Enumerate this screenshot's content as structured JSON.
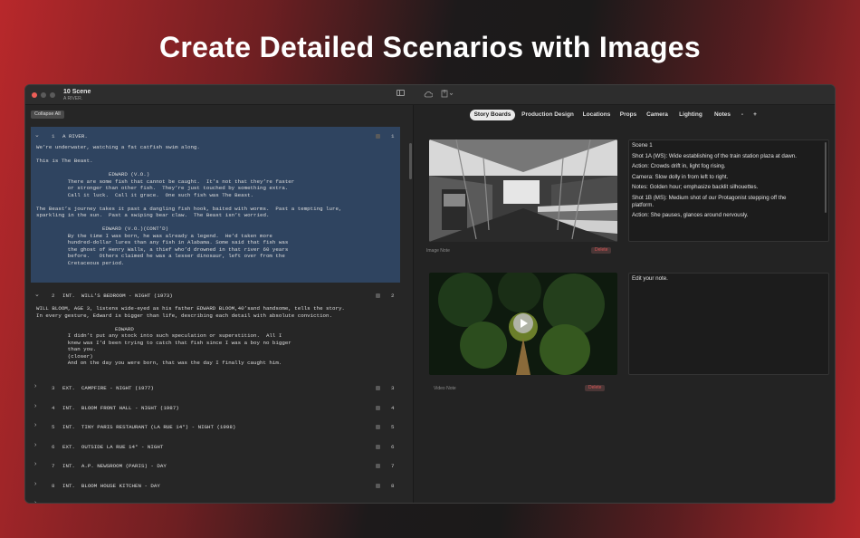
{
  "headline": "Create Detailed Scenarios with Images",
  "window": {
    "title": "10 Scene",
    "subtitle": "A RIVER."
  },
  "script": {
    "collapse_label": "Collapse All",
    "scene1": {
      "chevron": "⌄",
      "num": "1",
      "heading": "A RIVER.",
      "right_num": "1",
      "lines": [
        "We’re underwater, watching a fat catfish swim along.",
        "",
        "This is The Beast.",
        "",
        "                       EDWARD (V.O.)",
        "          There are some fish that cannot be caught.  It’s not that they’re faster",
        "          or stronger than other fish.  They’re just touched by something extra.",
        "          Call it luck.  Call it grace.  One such fish was The Beast.",
        "",
        "The Beast’s journey takes it past a dangling fish hook, baited with worms.  Past a tempting lure,",
        "sparkling in the sun.  Past a swiping bear claw.  The Beast isn’t worried.",
        "",
        "                     EDWARD (V.O.)(CONT’D)",
        "          By the time I was born, he was already a legend.  He’d taken more",
        "          hundred-dollar lures than any fish in Alabama. Some said that fish was",
        "          the ghost of Henry Walls, a thief who’d drowned in that river 60 years",
        "          before.   Others claimed he was a lesser dinosaur, left over from the",
        "          Cretaceous period."
      ]
    },
    "scene2": {
      "chevron": "⌄",
      "num": "2",
      "heading": "INT.  WILL’S BEDROOM - NIGHT (1973)",
      "right_num": "2",
      "lines": [
        "WILL BLOOM, AGE 3, listens wide-eyed as his father EDWARD BLOOM,40’sand handsome, tells the story.",
        "In every gesture, Edward is bigger than life, describing each detail with absolute conviction.",
        "",
        "                         EDWARD",
        "          I didn’t put any stock into such speculation or superstition.  All I",
        "          knew was I’d been trying to catch that fish since I was a boy no bigger",
        "          than you.",
        "          (closer)",
        "          And on the day you were born, that was the day I finally caught him."
      ]
    },
    "collapsed_scenes": [
      {
        "chevron": "›",
        "num": "3",
        "heading": "EXT.  CAMPFIRE - NIGHT (1977)",
        "right_num": "3"
      },
      {
        "chevron": "›",
        "num": "4",
        "heading": "INT.  BLOOM FRONT HALL - NIGHT (1987)",
        "right_num": "4"
      },
      {
        "chevron": "›",
        "num": "5",
        "heading": "INT.  TINY PARIS RESTAURANT (LA RUE 14°) - NIGHT (1998)",
        "right_num": "5"
      },
      {
        "chevron": "›",
        "num": "6",
        "heading": "EXT.  OUTSIDE LA RUE 14° - NIGHT",
        "right_num": "6"
      },
      {
        "chevron": "›",
        "num": "7",
        "heading": "INT.  A.P. NEWSROOM (PARIS) - DAY",
        "right_num": "7"
      },
      {
        "chevron": "›",
        "num": "8",
        "heading": "INT.  BLOOM HOUSE KITCHEN - DAY",
        "right_num": "8"
      },
      {
        "chevron": "›",
        "num": "9",
        "heading": "INT.  BLOOM HOUSE MASTER BEDROOM - NIGHT",
        "right_num": "9"
      }
    ]
  },
  "tabs": [
    "Story Boards",
    "Production Design",
    "Locations",
    "Props",
    "Camera",
    "Lighting",
    "Notes",
    "-",
    "+"
  ],
  "storyboard": {
    "image_note_label": "Image Note",
    "video_note_label": "Video Note",
    "delete_label": "Delete",
    "play_icon": "play-icon",
    "note1_lines": [
      "Scene 1",
      "",
      "Shot 1A (WS): Wide establishing of the train station plaza at dawn.",
      "",
      "Action: Crowds drift in, light fog rising.",
      "",
      "Camera: Slow dolly in from left to right.",
      "",
      "Notes: Golden hour; emphasize backlit silhouettes.",
      "",
      "Shot 1B (MS): Medium shot of our Protagonist stepping off the",
      "platform.",
      "",
      "Action: She pauses, glances around nervously."
    ],
    "note2_text": "Edit your note."
  },
  "colors": {
    "accent_red": "#b8282b",
    "selection": "#2f4460",
    "window_bg": "#262626"
  }
}
